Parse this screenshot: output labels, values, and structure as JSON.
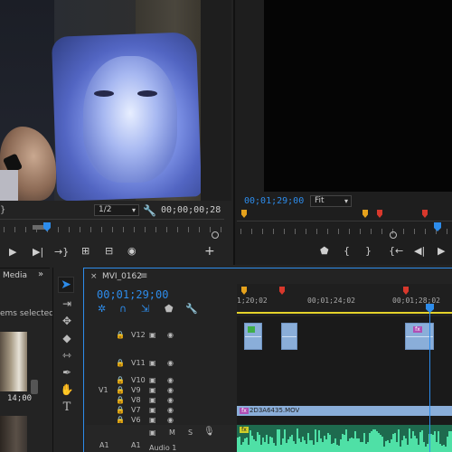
{
  "source_monitor": {
    "zoom": "1/2",
    "timecode": "00;00;00;28"
  },
  "program_monitor": {
    "timecode": "00;01;29;00",
    "fit": "Fit"
  },
  "media_panel": {
    "tab": "Media",
    "more": "»",
    "items_selected": "ems selected",
    "thumb_duration": "14;00"
  },
  "timeline": {
    "close": "×",
    "sequence_name": "MVI_0162",
    "menu": "≡",
    "timecode": "00;01;29;00",
    "ruler_labels": [
      "1;20;02",
      "00;01;24;02",
      "00;01;28;02"
    ],
    "tracks": [
      {
        "name": "V12",
        "target": ""
      },
      {
        "name": "V11",
        "target": ""
      },
      {
        "name": "V10",
        "target": ""
      },
      {
        "name": "V9",
        "target": "V1"
      },
      {
        "name": "V8",
        "target": ""
      },
      {
        "name": "V7",
        "target": ""
      },
      {
        "name": "V6",
        "target": ""
      }
    ],
    "v1_clip_label": "2D3A6435.MOV",
    "audio": {
      "target": "A1",
      "name": "A1",
      "label": "Audio 1",
      "m": "M",
      "s": "S"
    }
  },
  "colors": {
    "accent": "#2d8ceb",
    "marker_red": "#d8382c",
    "marker_orange": "#e6a21c",
    "clip_blue": "#8aaed9",
    "audio_green": "#1e6a4e"
  }
}
